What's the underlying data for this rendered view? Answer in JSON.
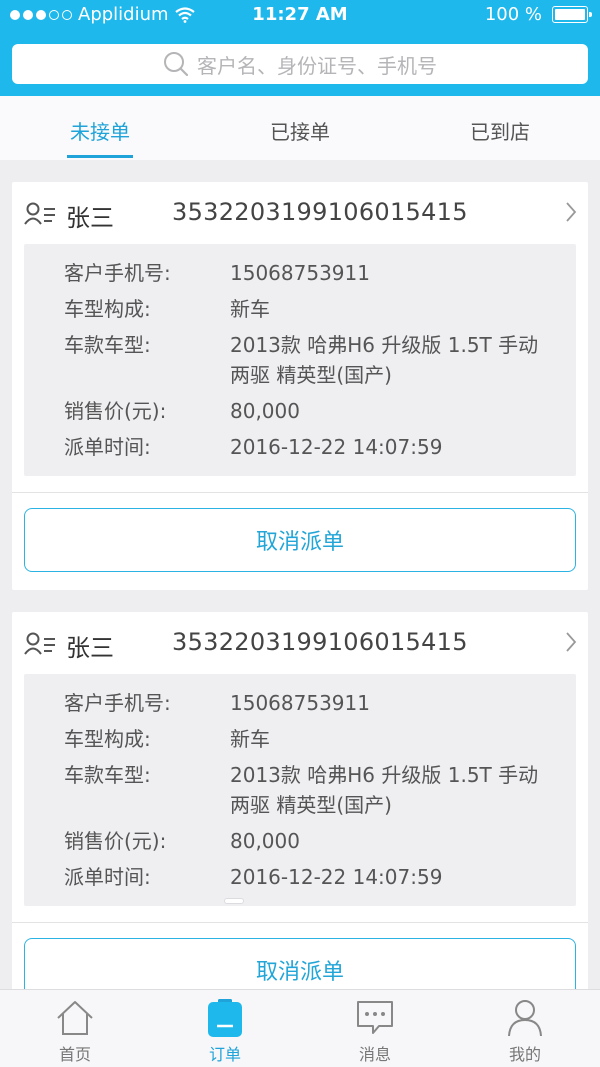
{
  "status_bar": {
    "carrier": "Applidium",
    "time": "11:27 AM",
    "battery": "100 %"
  },
  "search": {
    "placeholder": "客户名、身份证号、手机号"
  },
  "tabs": [
    {
      "label": "未接单",
      "active": true
    },
    {
      "label": "已接单",
      "active": false
    },
    {
      "label": "已到店",
      "active": false
    }
  ],
  "orders": [
    {
      "name": "张三",
      "id_number": "353220319910601541​5",
      "fields": [
        {
          "label": "客户手机号:",
          "value": "15068753911"
        },
        {
          "label": "车型构成:",
          "value": "新车"
        },
        {
          "label": "车款车型:",
          "value": "2013款 哈弗H6 升级版 1.5T 手动 两驱 精英型(国产)"
        },
        {
          "label": "销售价(元):",
          "value": "80,000"
        },
        {
          "label": "派单时间:",
          "value": "2016-12-22 14:07:59"
        }
      ],
      "action_label": "取消派单"
    },
    {
      "name": "张三",
      "id_number": "353220319910601541​5",
      "fields": [
        {
          "label": "客户手机号:",
          "value": "15068753911"
        },
        {
          "label": "车型构成:",
          "value": "新车"
        },
        {
          "label": "车款车型:",
          "value": "2013款 哈弗H6 升级版 1.5T 手动 两驱 精英型(国产)"
        },
        {
          "label": "销售价(元):",
          "value": "80,000"
        },
        {
          "label": "派单时间:",
          "value": "2016-12-22 14:07:59"
        }
      ],
      "action_label": "取消派单"
    }
  ],
  "bottom_nav": [
    {
      "label": "首页",
      "icon": "home-icon",
      "active": false
    },
    {
      "label": "订单",
      "icon": "order-icon",
      "active": true
    },
    {
      "label": "消息",
      "icon": "message-icon",
      "active": false
    },
    {
      "label": "我的",
      "icon": "profile-icon",
      "active": false
    }
  ],
  "colors": {
    "accent": "#1fb8ec",
    "active_text": "#1fa3d8"
  }
}
